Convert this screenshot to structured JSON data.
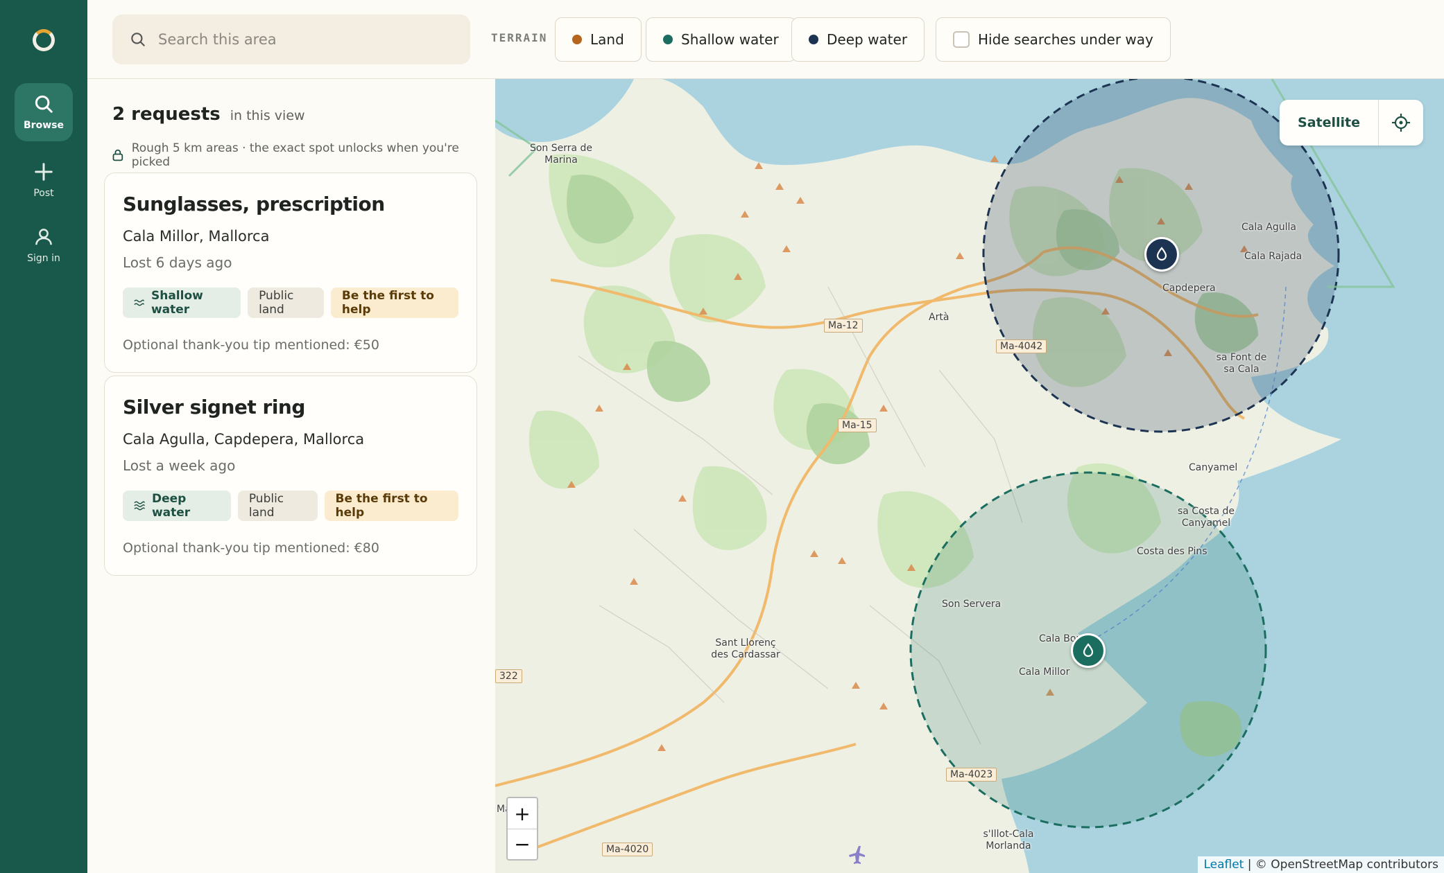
{
  "nav": {
    "items": [
      {
        "label": "Browse",
        "icon": "search-icon",
        "active": true
      },
      {
        "label": "Post",
        "icon": "plus-icon"
      },
      {
        "label": "Sign in",
        "icon": "user-icon"
      }
    ]
  },
  "topbar": {
    "search_placeholder": "Search this area",
    "terrain_label": "TERRAIN",
    "terrain_filters": [
      {
        "label": "Land",
        "color": "#b5651d"
      },
      {
        "label": "Shallow water",
        "color": "#1b6e5f"
      },
      {
        "label": "Deep water",
        "color": "#1c3352"
      }
    ],
    "hide_label": "Hide searches under way"
  },
  "panel": {
    "count": "2 requests",
    "count_suffix": "in this view",
    "privacy_note": "Rough 5 km areas · the exact spot unlocks when you're picked",
    "cards": [
      {
        "title": "Sunglasses, prescription",
        "location": "Cala Millor, Mallorca",
        "when": "Lost 6 days ago",
        "terrain_tag": "Shallow water",
        "land_tag": "Public land",
        "cta_tag": "Be the first to help",
        "tip": "Optional thank-you tip mentioned: €50"
      },
      {
        "title": "Silver signet ring",
        "location": "Cala Agulla, Capdepera, Mallorca",
        "when": "Lost a week ago",
        "terrain_tag": "Deep water",
        "land_tag": "Public land",
        "cta_tag": "Be the first to help",
        "tip": "Optional thank-you tip mentioned: €80"
      }
    ]
  },
  "map": {
    "satellite_label": "Satellite",
    "places": [
      "Son Serra de Marina",
      "Artà",
      "Cala Agulla",
      "Cala Rajada",
      "Capdepera",
      "sa Font de sa Cala",
      "Canyamel",
      "sa Costa de Canyamel",
      "Costa des Pins",
      "Son Servera",
      "Cala Bona",
      "Cala Millor",
      "Sant Llorenç des Cardassar",
      "s'Illot-Cala Morlanda",
      "Manacor"
    ],
    "roads": [
      "Ma-12",
      "Ma-4042",
      "Ma-15",
      "Ma-4023",
      "Ma-4020",
      "322"
    ],
    "zoom_in": "+",
    "zoom_out": "−",
    "attribution_link": "Leaflet",
    "attribution_rest": "| © OpenStreetMap contributors",
    "colors": {
      "sea": "#aad3df",
      "deep_area": "#1c3352",
      "shallow_area": "#1b6e5f"
    }
  }
}
